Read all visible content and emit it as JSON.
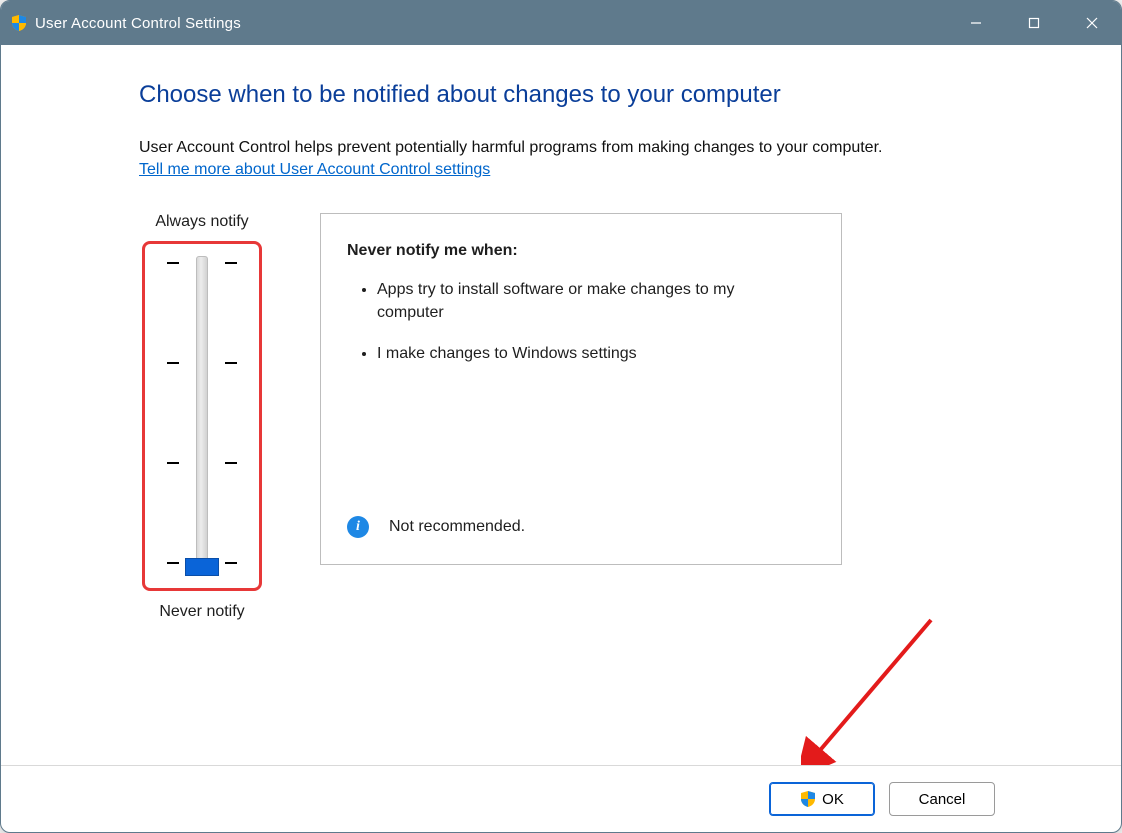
{
  "window": {
    "title": "User Account Control Settings"
  },
  "heading": "Choose when to be notified about changes to your computer",
  "intro": "User Account Control helps prevent potentially harmful programs from making changes to your computer.",
  "help_link": "Tell me more about User Account Control settings",
  "slider": {
    "top_label": "Always notify",
    "bottom_label": "Never notify",
    "levels": 4,
    "current_level": 0
  },
  "description": {
    "title": "Never notify me when:",
    "bullets": [
      "Apps try to install software or make changes to my computer",
      "I make changes to Windows settings"
    ],
    "status_text": "Not recommended.",
    "status_kind": "info"
  },
  "buttons": {
    "ok": "OK",
    "cancel": "Cancel"
  }
}
